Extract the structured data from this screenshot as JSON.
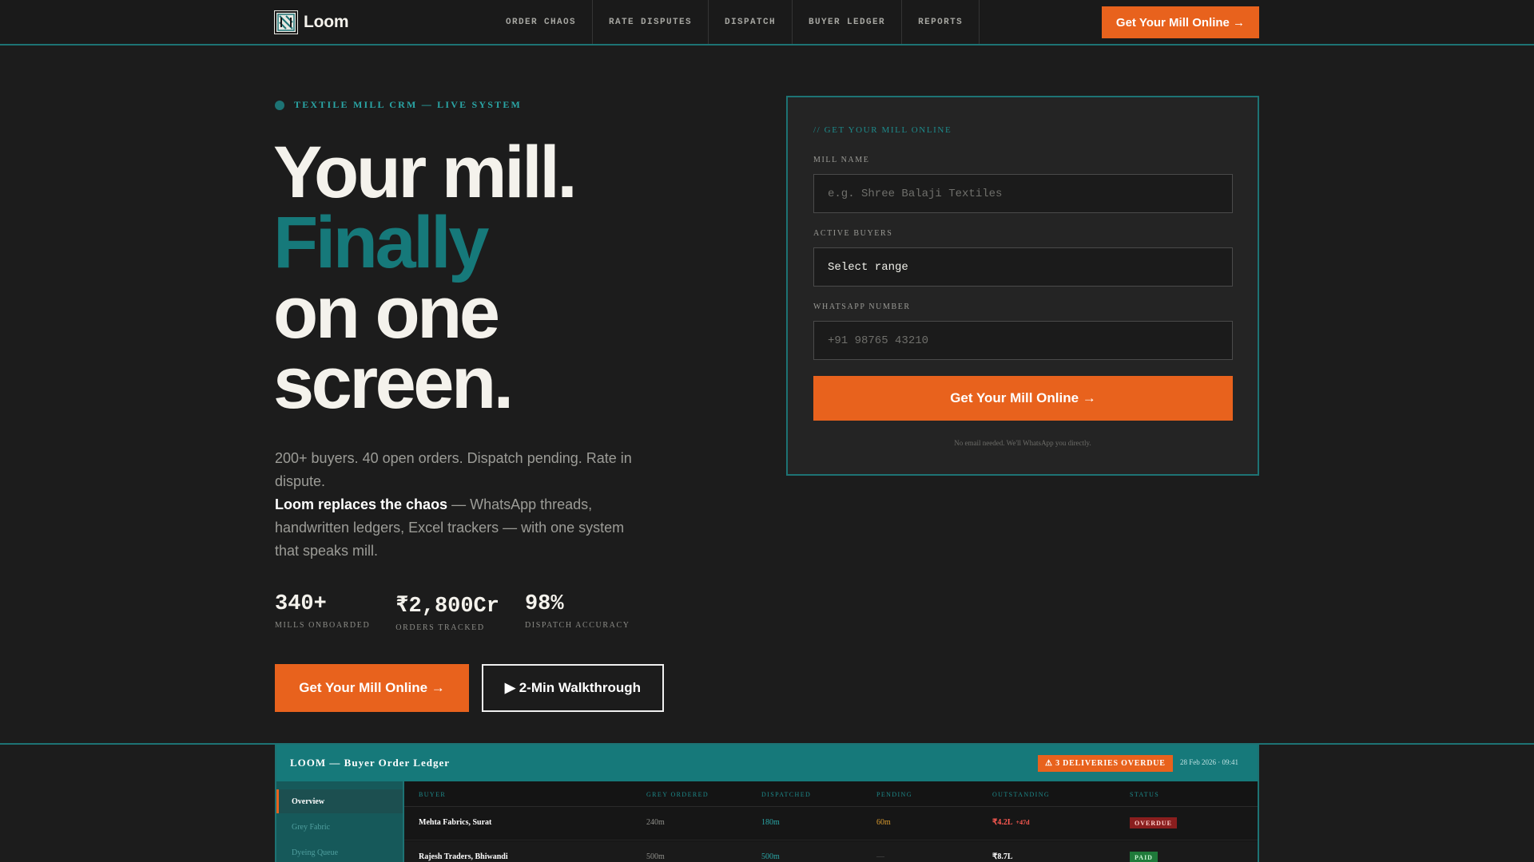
{
  "nav": {
    "logo_text": "Loom",
    "links": [
      "ORDER CHAOS",
      "RATE DISPUTES",
      "DISPATCH",
      "BUYER LEDGER",
      "REPORTS"
    ],
    "cta_label": "Get Your Mill Online →"
  },
  "hero": {
    "eyebrow": "TEXTILE MILL CRM — LIVE SYSTEM",
    "headline": {
      "line1": "Your mill.",
      "line2": "Finally",
      "line3": "on one",
      "line4": "screen."
    },
    "sub": {
      "p1": "200+ buyers. 40 open orders. Dispatch pending. Rate in dispute.",
      "strong": "Loom replaces the chaos",
      "p2": " — WhatsApp threads, handwritten ledgers, Excel trackers — with one system that speaks mill."
    },
    "stats": [
      {
        "value": "340+",
        "label": "MILLS ONBOARDED"
      },
      {
        "value": "₹2,800Cr",
        "label": "ORDERS TRACKED"
      },
      {
        "value": "98%",
        "label": "DISPATCH ACCURACY"
      }
    ],
    "primary_cta": "Get Your Mill Online →",
    "secondary_cta": "▶ 2-Min Walkthrough"
  },
  "form": {
    "eyebrow": "// GET YOUR MILL ONLINE",
    "mill_name_label": "MILL NAME",
    "mill_name_placeholder": "e.g. Shree Balaji Textiles",
    "buyers_label": "ACTIVE BUYERS",
    "buyers_value": "Select range",
    "whatsapp_label": "WHATSAPP NUMBER",
    "whatsapp_placeholder": "+91 98765 43210",
    "submit_label": "Get Your Mill Online →",
    "note": "No email needed. We'll WhatsApp you directly."
  },
  "dashboard": {
    "title": "LOOM — Buyer Order Ledger",
    "alert": "⚠ 3 DELIVERIES OVERDUE",
    "timestamp": "28 Feb 2026 · 09:41",
    "sidebar": [
      "Overview",
      "Grey Fabric",
      "Dyeing Queue"
    ],
    "columns": [
      "BUYER",
      "GREY ORDERED",
      "DISPATCHED",
      "PENDING",
      "OUTSTANDING",
      "STATUS"
    ],
    "rows": [
      {
        "buyer": "Mehta Fabrics, Surat",
        "ordered": "240m",
        "dispatched": "180m",
        "pending": "60m",
        "outstanding": "₹4.2L",
        "age": "+47d",
        "status": "OVERDUE"
      },
      {
        "buyer": "Rajesh Traders, Bhiwandi",
        "ordered": "500m",
        "dispatched": "500m",
        "pending": "—",
        "outstanding": "₹8.7L",
        "age": "",
        "status": "PAID"
      }
    ]
  },
  "colors": {
    "accent_orange": "#e8621d",
    "accent_teal": "#16797a",
    "background": "#1c1c1c"
  }
}
